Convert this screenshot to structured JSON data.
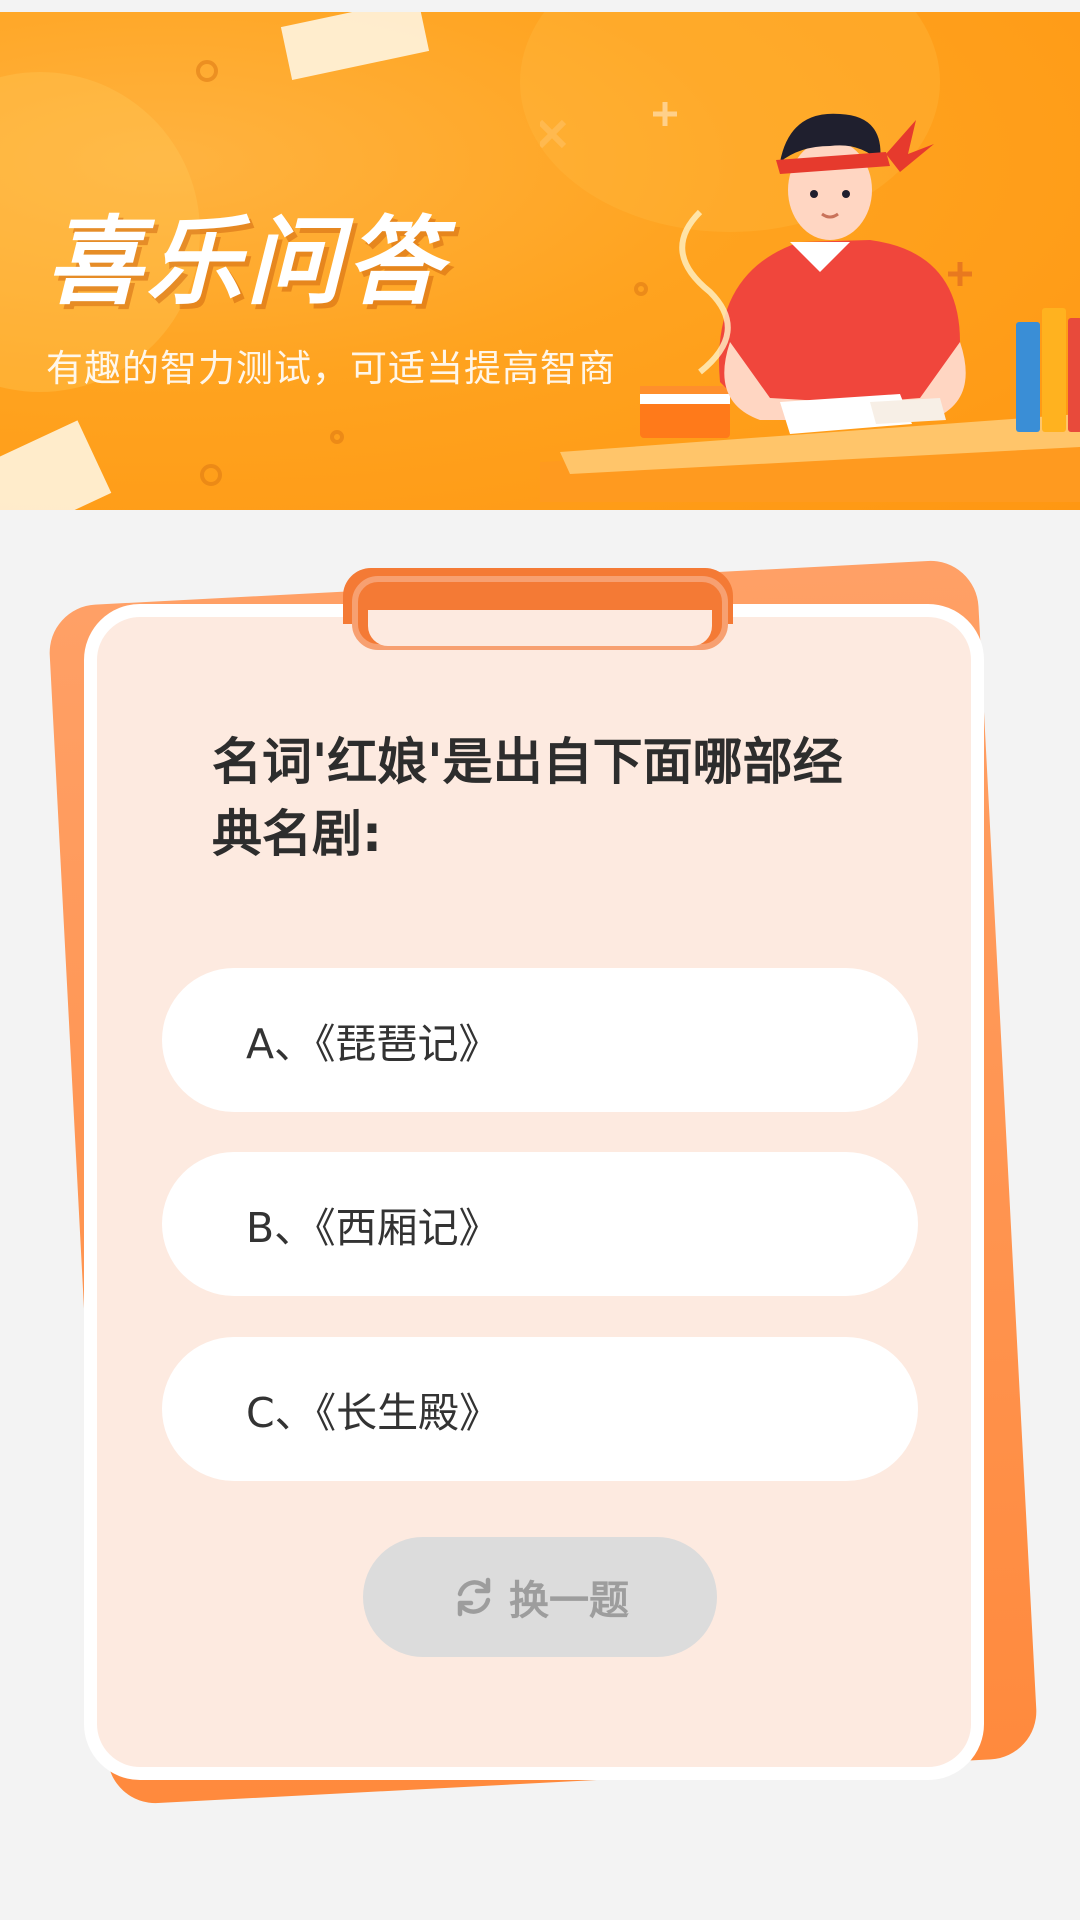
{
  "banner": {
    "title": "喜乐问答",
    "subtitle": "有趣的智力测试，可适当提高智商"
  },
  "quiz": {
    "question": "名词'红娘'是出自下面哪部经典名剧:",
    "options": [
      {
        "label": "A、《琵琶记》"
      },
      {
        "label": "B、《西厢记》"
      },
      {
        "label": "C、《长生殿》"
      }
    ],
    "change_button": {
      "label": "换一题",
      "icon": "refresh-icon"
    }
  },
  "colors": {
    "banner_orange": "#ffa31f",
    "card_background": "#fdeae0",
    "card_back_orange": "#ff8a3d",
    "clip_orange": "#f47a35",
    "button_gray": "#dcdcdc"
  }
}
